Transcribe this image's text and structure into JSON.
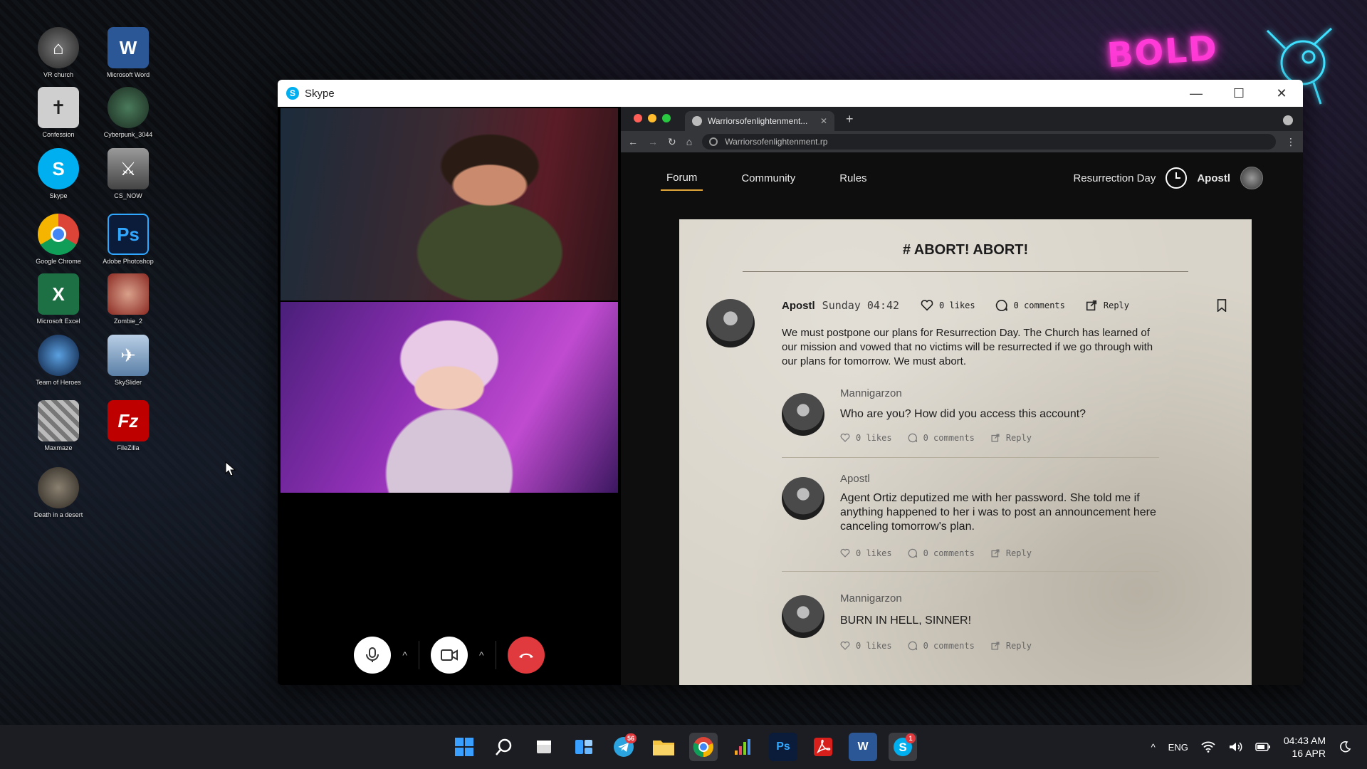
{
  "desktop": {
    "icons": [
      {
        "label": "VR church"
      },
      {
        "label": "Microsoft Word"
      },
      {
        "label": "Confession"
      },
      {
        "label": "Cyberpunk_3044"
      },
      {
        "label": "Skype"
      },
      {
        "label": "CS_NOW"
      },
      {
        "label": "Google Chrome"
      },
      {
        "label": "Adobe Photoshop"
      },
      {
        "label": "Microsoft Excel"
      },
      {
        "label": "Zombie_2"
      },
      {
        "label": "Team of Heroes"
      },
      {
        "label": "SkySlider"
      },
      {
        "label": "Maxmaze"
      },
      {
        "label": "FileZilla"
      },
      {
        "label": "Death in a desert"
      }
    ],
    "wallpaper_logo": "BOLD"
  },
  "skype": {
    "title": "Skype",
    "controls": {
      "minimize": "—",
      "maximize": "☐",
      "close": "✕"
    }
  },
  "browser": {
    "tab_title": "Warriorsofenlightenment...",
    "url": "Warriorsofenlightenment.rp"
  },
  "site": {
    "nav": {
      "forum": "Forum",
      "community": "Community",
      "rules": "Rules"
    },
    "event": "Resurrection Day",
    "user": "Apostl"
  },
  "post": {
    "title": "# ABORT! ABORT!",
    "author": "Apostl",
    "time": "Sunday 04:42",
    "likes": "0 likes",
    "comments": "0 comments",
    "reply": "Reply",
    "body": "We must postpone our plans for Resurrection Day. The Church has learned of our mission and vowed that no victims will be resurrected if we go through with our plans for tomorrow. We must abort."
  },
  "comments": [
    {
      "author": "Mannigarzon",
      "body": "Who are you? How did you access this account?",
      "likes": "0 likes",
      "comments": "0 comments",
      "reply": "Reply"
    },
    {
      "author": "Apostl",
      "body": "Agent Ortiz deputized me with her password. She told me if anything happened to her i was to post an announcement here canceling tomorrow's plan.",
      "likes": "0 likes",
      "comments": "0 comments",
      "reply": "Reply"
    },
    {
      "author": "Mannigarzon",
      "body": "BURN IN HELL, SINNER!",
      "likes": "0 likes",
      "comments": "0 comments",
      "reply": "Reply"
    }
  ],
  "taskbar": {
    "telegram_badge": "56",
    "skype_badge": "1",
    "ps_label": "Ps",
    "word_label": "W",
    "language": "ENG",
    "time": "04:43 AM",
    "date": "16 APR"
  }
}
